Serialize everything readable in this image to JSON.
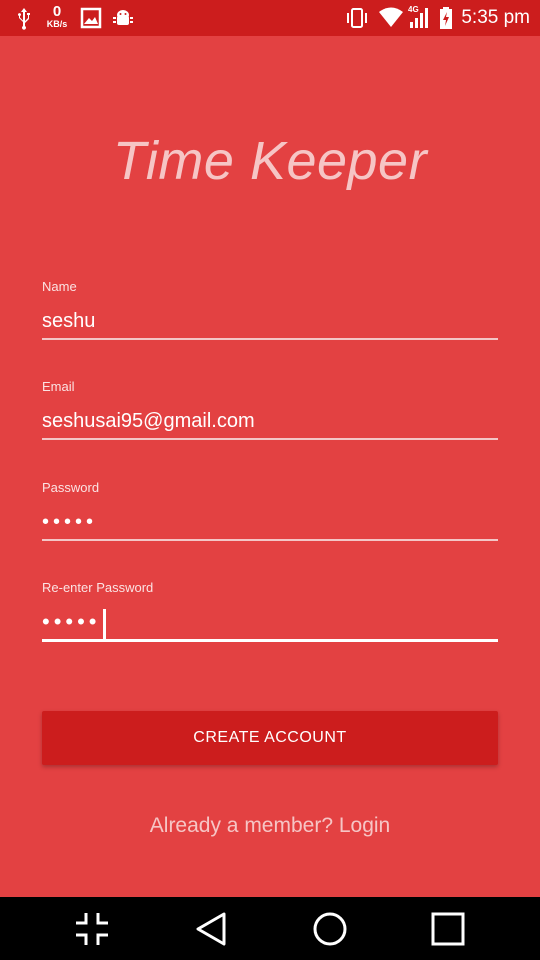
{
  "status_bar": {
    "speed_value": "0",
    "speed_unit": "KB/s",
    "network": "4G",
    "time": "5:35 pm",
    "icons": [
      "usb-icon",
      "image-icon",
      "android-debug-icon",
      "vibrate-icon",
      "wifi-icon",
      "signal-icon",
      "battery-charging-icon"
    ]
  },
  "app": {
    "title": "Time Keeper"
  },
  "form": {
    "name": {
      "label": "Name",
      "value": "seshu"
    },
    "email": {
      "label": "Email",
      "value": "seshusai95@gmail.com"
    },
    "password": {
      "label": "Password",
      "value": "•••••"
    },
    "reenter_password": {
      "label": "Re-enter Password",
      "value": "•••••"
    }
  },
  "actions": {
    "create_account": "CREATE ACCOUNT",
    "login_link": "Already a member? Login"
  },
  "colors": {
    "background": "#e34142",
    "status_bar": "#cc1d1d",
    "button": "#cc1d1d",
    "title": "#f6c5c5"
  },
  "navigation": {
    "icons": [
      "collapse-icon",
      "back-icon",
      "home-icon",
      "recents-icon"
    ]
  }
}
